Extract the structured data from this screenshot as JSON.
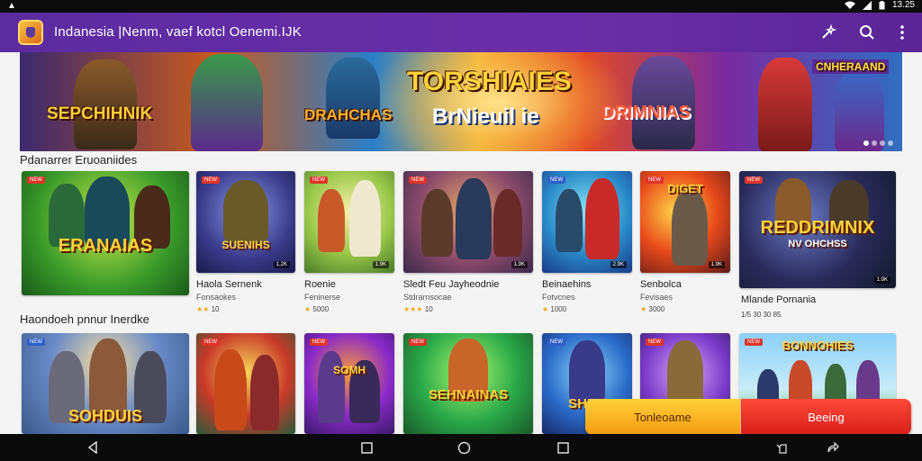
{
  "status": {
    "left": "▲",
    "time": "13.25"
  },
  "app": {
    "title": "Indanesia |Nenm, vaef kotcl Oenemi.IJK"
  },
  "banner": {
    "main_title": "TORSHIAIES",
    "sub_title": "BrNieuil ie",
    "left_text": "SEPCHIHNIK",
    "mid_text": "DRAHCHAS",
    "right_text": "DRIMNIAS",
    "top_right_text": "CNHERAAND"
  },
  "sections": [
    {
      "title": "Pdanarrer Eruoaniides",
      "cards": [
        {
          "name": "",
          "genre": "",
          "rating": "",
          "overlay": "ERANAIAS",
          "tag": "NEW"
        },
        {
          "name": "Haola Sernenk",
          "genre": "Fonsaokes",
          "rating": "★★ 10",
          "overlay": "SUENIHS",
          "tag": "NEW",
          "count": "1.2K"
        },
        {
          "name": "Roenie",
          "genre": "Feninerse",
          "rating": "★ 5000",
          "overlay": "",
          "tag": "NEW",
          "count": "1.9K"
        },
        {
          "name": "Sledt Feu Jayheodnie",
          "genre": "Stdrarnsocae",
          "rating": "★★★ 10",
          "overlay": "",
          "tag": "NEW",
          "count": "1.9K"
        },
        {
          "name": "Beinaehins",
          "genre": "Fotvcnes",
          "rating": "★ 1000",
          "overlay": "",
          "tag": "NEW",
          "count": "2.9K"
        },
        {
          "name": "Senbolca",
          "genre": "Fevisaes",
          "rating": "★ 3000",
          "overlay": "DIGET",
          "tag": "NEW",
          "count": "1.9K"
        },
        {
          "name": "Mlande Pornania",
          "genre": "",
          "rating": "1/5 30 30 85",
          "overlay": "REDDRIMNIX",
          "overlay2": "NV OHCHSS",
          "tag": "NEW",
          "count": "1.9K"
        }
      ]
    },
    {
      "title": "Haondoeh pnnur Inerdke",
      "cards": [
        {
          "overlay": "SOHDUIS",
          "tag": "NEW"
        },
        {
          "overlay": "",
          "tag": "NEW"
        },
        {
          "overlay": "SOMH",
          "tag": "NEW"
        },
        {
          "overlay": "SEHNAINAS",
          "tag": "NEW"
        },
        {
          "overlay": "SHEN",
          "tag": "NEW"
        },
        {
          "overlay": "",
          "tag": "NEW"
        },
        {
          "overlay": "BONNOHIES",
          "tag": "NEW"
        }
      ]
    }
  ],
  "cta": {
    "left": "Tonleoame",
    "right": "Beeing"
  },
  "colors": {
    "appbar": "#5b2ba0",
    "cta_left": "#f5b21c",
    "cta_right": "#e02a22"
  }
}
